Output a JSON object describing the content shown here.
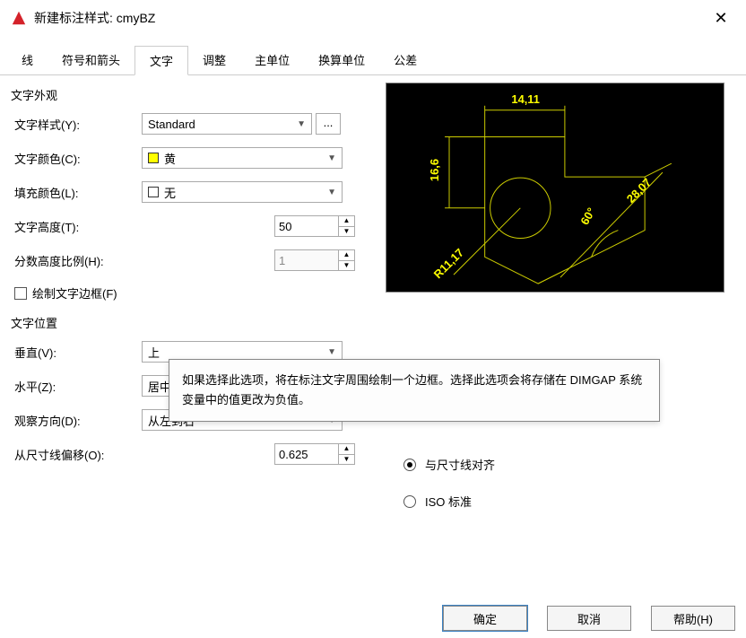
{
  "window": {
    "title": "新建标注样式: cmyBZ"
  },
  "tabs": [
    "线",
    "符号和箭头",
    "文字",
    "调整",
    "主单位",
    "换算单位",
    "公差"
  ],
  "active_tab": "文字",
  "appearance": {
    "group": "文字外观",
    "style_label": "文字样式(Y):",
    "style_value": "Standard",
    "color_label": "文字颜色(C):",
    "color_value": "黄",
    "color_swatch": "#ffff00",
    "fill_label": "填充颜色(L):",
    "fill_value": "无",
    "height_label": "文字高度(T):",
    "height_value": "50",
    "frac_label": "分数高度比例(H):",
    "frac_value": "1",
    "frame_label": "绘制文字边框(F)"
  },
  "placement": {
    "group": "文字位置",
    "vert_label": "垂直(V):",
    "vert_value": "上",
    "horiz_label": "水平(Z):",
    "horiz_value": "居中",
    "view_label": "观察方向(D):",
    "view_value": "从左到右",
    "offset_label": "从尺寸线偏移(O):",
    "offset_value": "0.625"
  },
  "alignment": {
    "opt_dim": "与尺寸线对齐",
    "opt_iso": "ISO 标准"
  },
  "tooltip": "如果选择此选项，将在标注文字周围绘制一个边框。选择此选项会将存储在 DIMGAP 系统变量中的值更改为负值。",
  "preview_dims": {
    "top": "14,11",
    "left": "16,6",
    "radius": "R11,17",
    "angle": "60°",
    "diag": "28,07"
  },
  "buttons": {
    "ok": "确定",
    "cancel": "取消",
    "help": "帮助(H)",
    "more": "..."
  }
}
